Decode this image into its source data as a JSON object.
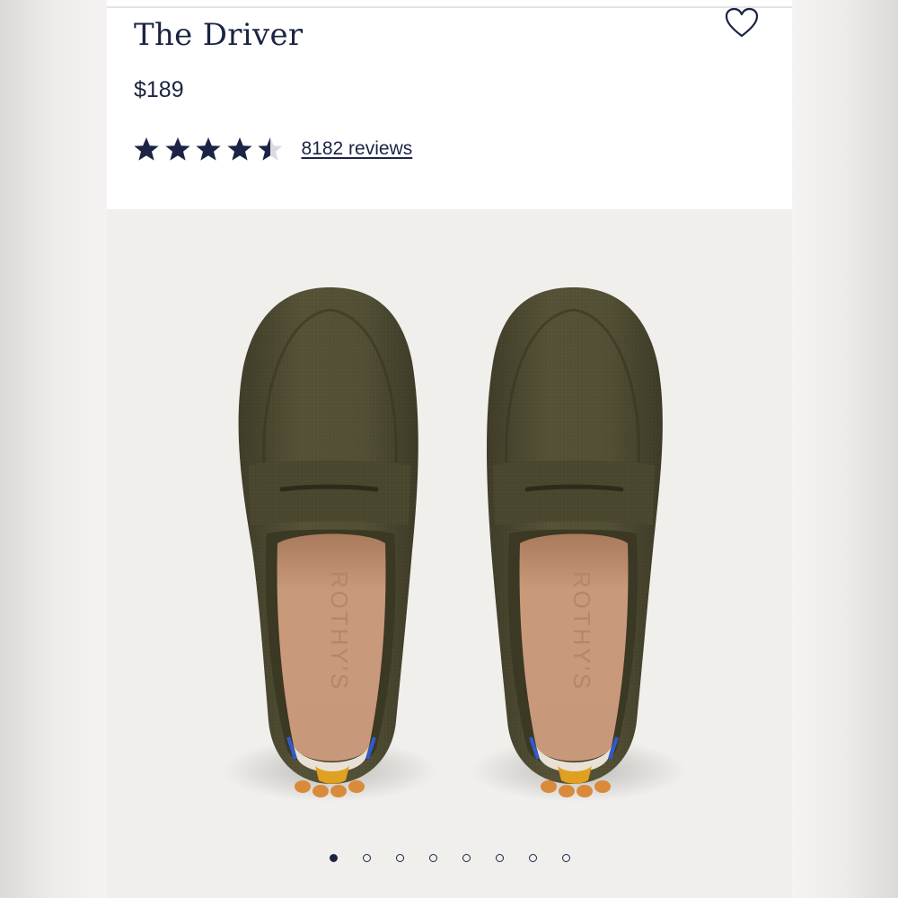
{
  "product": {
    "title": "The Driver",
    "price": "$189"
  },
  "rating": {
    "value": 4.5,
    "max": 5,
    "reviews_link": "8182 reviews"
  },
  "icons": {
    "wishlist": "heart-outline-icon",
    "star": "star-icon"
  },
  "shoe": {
    "brand_mark": "ROTHY'S"
  },
  "carousel": {
    "total_slides": 8,
    "active_slide": 1
  },
  "colors": {
    "navy": "#1b2444",
    "shoe_olive": "#4d4a32",
    "insole": "#c49272",
    "sole_orange": "#d98a3a",
    "gallery_bg": "#f0efec"
  }
}
